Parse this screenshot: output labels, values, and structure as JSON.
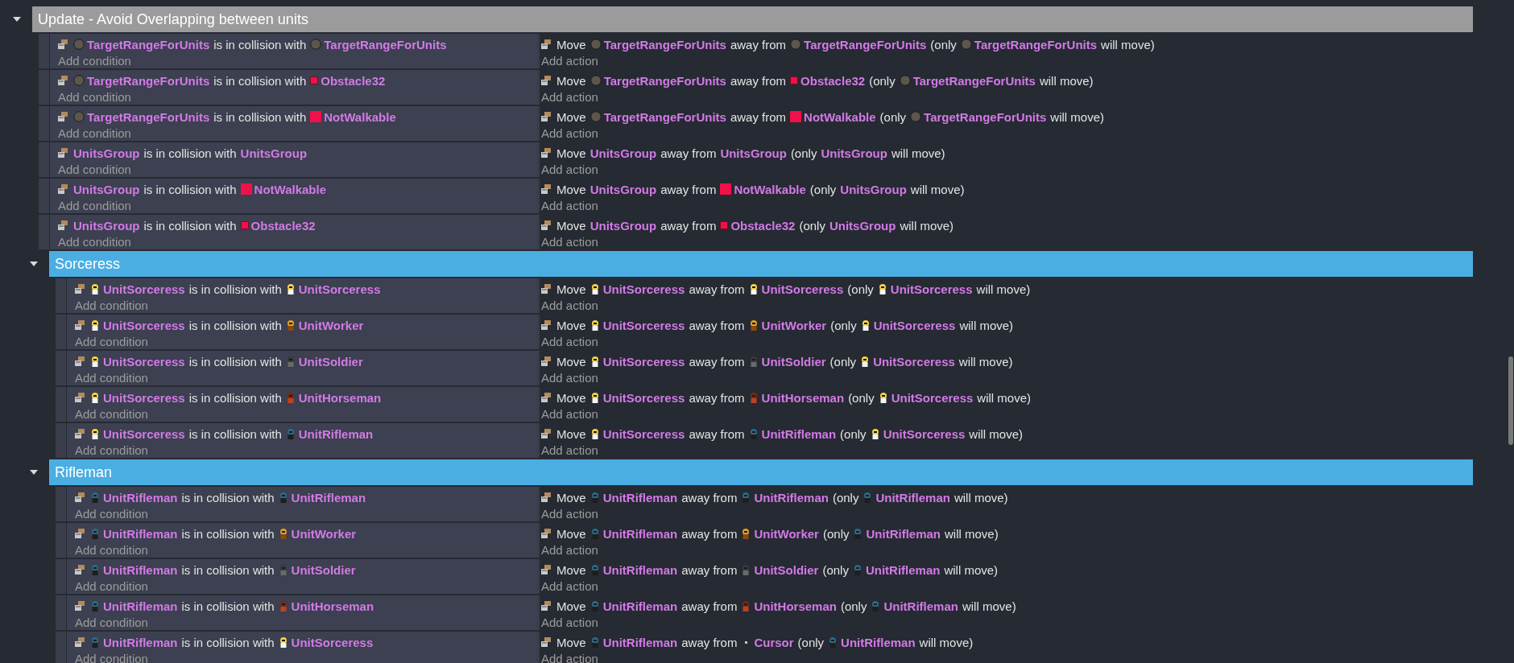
{
  "groups": [
    {
      "title": "Update - Avoid Overlapping between units",
      "color": "#9b9b9b",
      "expanded": true,
      "events": [
        {
          "condition": [
            {
              "kind": "circle",
              "text": "TargetRangeForUnits"
            },
            {
              "kind": "text",
              "text": "is in collision with"
            },
            {
              "kind": "circle",
              "text": "TargetRangeForUnits"
            }
          ],
          "add_condition": "Add condition",
          "action": [
            {
              "kind": "text",
              "text": "Move"
            },
            {
              "kind": "circle",
              "text": "TargetRangeForUnits"
            },
            {
              "kind": "text",
              "text": "away from"
            },
            {
              "kind": "circle",
              "text": "TargetRangeForUnits"
            },
            {
              "kind": "text",
              "text": "(only"
            },
            {
              "kind": "circle",
              "text": "TargetRangeForUnits"
            },
            {
              "kind": "text",
              "text": "will move)"
            }
          ],
          "add_action": "Add action"
        },
        {
          "condition": [
            {
              "kind": "circle",
              "text": "TargetRangeForUnits"
            },
            {
              "kind": "text",
              "text": "is in collision with"
            },
            {
              "kind": "tile",
              "text": "Obstacle32"
            }
          ],
          "add_condition": "Add condition",
          "action": [
            {
              "kind": "text",
              "text": "Move"
            },
            {
              "kind": "circle",
              "text": "TargetRangeForUnits"
            },
            {
              "kind": "text",
              "text": "away from"
            },
            {
              "kind": "tile",
              "text": "Obstacle32"
            },
            {
              "kind": "text",
              "text": "(only"
            },
            {
              "kind": "circle",
              "text": "TargetRangeForUnits"
            },
            {
              "kind": "text",
              "text": "will move)"
            }
          ],
          "add_action": "Add action"
        },
        {
          "condition": [
            {
              "kind": "circle",
              "text": "TargetRangeForUnits"
            },
            {
              "kind": "text",
              "text": "is in collision with"
            },
            {
              "kind": "square",
              "text": "NotWalkable"
            }
          ],
          "add_condition": "Add condition",
          "action": [
            {
              "kind": "text",
              "text": "Move"
            },
            {
              "kind": "circle",
              "text": "TargetRangeForUnits"
            },
            {
              "kind": "text",
              "text": "away from"
            },
            {
              "kind": "square",
              "text": "NotWalkable"
            },
            {
              "kind": "text",
              "text": "(only"
            },
            {
              "kind": "circle",
              "text": "TargetRangeForUnits"
            },
            {
              "kind": "text",
              "text": "will move)"
            }
          ],
          "add_action": "Add action"
        },
        {
          "condition": [
            {
              "kind": "group",
              "text": "UnitsGroup"
            },
            {
              "kind": "text",
              "text": "is in collision with"
            },
            {
              "kind": "group",
              "text": "UnitsGroup"
            }
          ],
          "add_condition": "Add condition",
          "action": [
            {
              "kind": "text",
              "text": "Move"
            },
            {
              "kind": "group",
              "text": "UnitsGroup"
            },
            {
              "kind": "text",
              "text": "away from"
            },
            {
              "kind": "group",
              "text": "UnitsGroup"
            },
            {
              "kind": "text",
              "text": "(only"
            },
            {
              "kind": "group",
              "text": "UnitsGroup"
            },
            {
              "kind": "text",
              "text": "will move)"
            }
          ],
          "add_action": "Add action"
        },
        {
          "condition": [
            {
              "kind": "group",
              "text": "UnitsGroup"
            },
            {
              "kind": "text",
              "text": "is in collision with"
            },
            {
              "kind": "square",
              "text": "NotWalkable"
            }
          ],
          "add_condition": "Add condition",
          "action": [
            {
              "kind": "text",
              "text": "Move"
            },
            {
              "kind": "group",
              "text": "UnitsGroup"
            },
            {
              "kind": "text",
              "text": "away from"
            },
            {
              "kind": "square",
              "text": "NotWalkable"
            },
            {
              "kind": "text",
              "text": "(only"
            },
            {
              "kind": "group",
              "text": "UnitsGroup"
            },
            {
              "kind": "text",
              "text": "will move)"
            }
          ],
          "add_action": "Add action"
        },
        {
          "condition": [
            {
              "kind": "group",
              "text": "UnitsGroup"
            },
            {
              "kind": "text",
              "text": "is in collision with"
            },
            {
              "kind": "tile",
              "text": "Obstacle32"
            }
          ],
          "add_condition": "Add condition",
          "action": [
            {
              "kind": "text",
              "text": "Move"
            },
            {
              "kind": "group",
              "text": "UnitsGroup"
            },
            {
              "kind": "text",
              "text": "away from"
            },
            {
              "kind": "tile",
              "text": "Obstacle32"
            },
            {
              "kind": "text",
              "text": "(only"
            },
            {
              "kind": "group",
              "text": "UnitsGroup"
            },
            {
              "kind": "text",
              "text": "will move)"
            }
          ],
          "add_action": "Add action"
        }
      ],
      "children": [
        {
          "title": "Sorceress",
          "color": "#4aaee2",
          "expanded": true,
          "events": [
            {
              "condition": [
                {
                  "kind": "sorceress",
                  "text": "UnitSorceress"
                },
                {
                  "kind": "text",
                  "text": "is in collision with"
                },
                {
                  "kind": "sorceress",
                  "text": "UnitSorceress"
                }
              ],
              "add_condition": "Add condition",
              "action": [
                {
                  "kind": "text",
                  "text": "Move"
                },
                {
                  "kind": "sorceress",
                  "text": "UnitSorceress"
                },
                {
                  "kind": "text",
                  "text": "away from"
                },
                {
                  "kind": "sorceress",
                  "text": "UnitSorceress"
                },
                {
                  "kind": "text",
                  "text": "(only"
                },
                {
                  "kind": "sorceress",
                  "text": "UnitSorceress"
                },
                {
                  "kind": "text",
                  "text": "will move)"
                }
              ],
              "add_action": "Add action"
            },
            {
              "condition": [
                {
                  "kind": "sorceress",
                  "text": "UnitSorceress"
                },
                {
                  "kind": "text",
                  "text": "is in collision with"
                },
                {
                  "kind": "worker",
                  "text": "UnitWorker"
                }
              ],
              "add_condition": "Add condition",
              "action": [
                {
                  "kind": "text",
                  "text": "Move"
                },
                {
                  "kind": "sorceress",
                  "text": "UnitSorceress"
                },
                {
                  "kind": "text",
                  "text": "away from"
                },
                {
                  "kind": "worker",
                  "text": "UnitWorker"
                },
                {
                  "kind": "text",
                  "text": "(only"
                },
                {
                  "kind": "sorceress",
                  "text": "UnitSorceress"
                },
                {
                  "kind": "text",
                  "text": "will move)"
                }
              ],
              "add_action": "Add action"
            },
            {
              "condition": [
                {
                  "kind": "sorceress",
                  "text": "UnitSorceress"
                },
                {
                  "kind": "text",
                  "text": "is in collision with"
                },
                {
                  "kind": "soldier",
                  "text": "UnitSoldier"
                }
              ],
              "add_condition": "Add condition",
              "action": [
                {
                  "kind": "text",
                  "text": "Move"
                },
                {
                  "kind": "sorceress",
                  "text": "UnitSorceress"
                },
                {
                  "kind": "text",
                  "text": "away from"
                },
                {
                  "kind": "soldier",
                  "text": "UnitSoldier"
                },
                {
                  "kind": "text",
                  "text": "(only"
                },
                {
                  "kind": "sorceress",
                  "text": "UnitSorceress"
                },
                {
                  "kind": "text",
                  "text": "will move)"
                }
              ],
              "add_action": "Add action"
            },
            {
              "condition": [
                {
                  "kind": "sorceress",
                  "text": "UnitSorceress"
                },
                {
                  "kind": "text",
                  "text": "is in collision with"
                },
                {
                  "kind": "horseman",
                  "text": "UnitHorseman"
                }
              ],
              "add_condition": "Add condition",
              "action": [
                {
                  "kind": "text",
                  "text": "Move"
                },
                {
                  "kind": "sorceress",
                  "text": "UnitSorceress"
                },
                {
                  "kind": "text",
                  "text": "away from"
                },
                {
                  "kind": "horseman",
                  "text": "UnitHorseman"
                },
                {
                  "kind": "text",
                  "text": "(only"
                },
                {
                  "kind": "sorceress",
                  "text": "UnitSorceress"
                },
                {
                  "kind": "text",
                  "text": "will move)"
                }
              ],
              "add_action": "Add action"
            },
            {
              "condition": [
                {
                  "kind": "sorceress",
                  "text": "UnitSorceress"
                },
                {
                  "kind": "text",
                  "text": "is in collision with"
                },
                {
                  "kind": "rifleman",
                  "text": "UnitRifleman"
                }
              ],
              "add_condition": "Add condition",
              "action": [
                {
                  "kind": "text",
                  "text": "Move"
                },
                {
                  "kind": "sorceress",
                  "text": "UnitSorceress"
                },
                {
                  "kind": "text",
                  "text": "away from"
                },
                {
                  "kind": "rifleman",
                  "text": "UnitRifleman"
                },
                {
                  "kind": "text",
                  "text": "(only"
                },
                {
                  "kind": "sorceress",
                  "text": "UnitSorceress"
                },
                {
                  "kind": "text",
                  "text": "will move)"
                }
              ],
              "add_action": "Add action"
            }
          ]
        },
        {
          "title": "Rifleman",
          "color": "#4aaee2",
          "expanded": true,
          "events": [
            {
              "condition": [
                {
                  "kind": "rifleman",
                  "text": "UnitRifleman"
                },
                {
                  "kind": "text",
                  "text": "is in collision with"
                },
                {
                  "kind": "rifleman",
                  "text": "UnitRifleman"
                }
              ],
              "add_condition": "Add condition",
              "action": [
                {
                  "kind": "text",
                  "text": "Move"
                },
                {
                  "kind": "rifleman",
                  "text": "UnitRifleman"
                },
                {
                  "kind": "text",
                  "text": "away from"
                },
                {
                  "kind": "rifleman",
                  "text": "UnitRifleman"
                },
                {
                  "kind": "text",
                  "text": "(only"
                },
                {
                  "kind": "rifleman",
                  "text": "UnitRifleman"
                },
                {
                  "kind": "text",
                  "text": "will move)"
                }
              ],
              "add_action": "Add action"
            },
            {
              "condition": [
                {
                  "kind": "rifleman",
                  "text": "UnitRifleman"
                },
                {
                  "kind": "text",
                  "text": "is in collision with"
                },
                {
                  "kind": "worker",
                  "text": "UnitWorker"
                }
              ],
              "add_condition": "Add condition",
              "action": [
                {
                  "kind": "text",
                  "text": "Move"
                },
                {
                  "kind": "rifleman",
                  "text": "UnitRifleman"
                },
                {
                  "kind": "text",
                  "text": "away from"
                },
                {
                  "kind": "worker",
                  "text": "UnitWorker"
                },
                {
                  "kind": "text",
                  "text": "(only"
                },
                {
                  "kind": "rifleman",
                  "text": "UnitRifleman"
                },
                {
                  "kind": "text",
                  "text": "will move)"
                }
              ],
              "add_action": "Add action"
            },
            {
              "condition": [
                {
                  "kind": "rifleman",
                  "text": "UnitRifleman"
                },
                {
                  "kind": "text",
                  "text": "is in collision with"
                },
                {
                  "kind": "soldier",
                  "text": "UnitSoldier"
                }
              ],
              "add_condition": "Add condition",
              "action": [
                {
                  "kind": "text",
                  "text": "Move"
                },
                {
                  "kind": "rifleman",
                  "text": "UnitRifleman"
                },
                {
                  "kind": "text",
                  "text": "away from"
                },
                {
                  "kind": "soldier",
                  "text": "UnitSoldier"
                },
                {
                  "kind": "text",
                  "text": "(only"
                },
                {
                  "kind": "rifleman",
                  "text": "UnitRifleman"
                },
                {
                  "kind": "text",
                  "text": "will move)"
                }
              ],
              "add_action": "Add action"
            },
            {
              "condition": [
                {
                  "kind": "rifleman",
                  "text": "UnitRifleman"
                },
                {
                  "kind": "text",
                  "text": "is in collision with"
                },
                {
                  "kind": "horseman",
                  "text": "UnitHorseman"
                }
              ],
              "add_condition": "Add condition",
              "action": [
                {
                  "kind": "text",
                  "text": "Move"
                },
                {
                  "kind": "rifleman",
                  "text": "UnitRifleman"
                },
                {
                  "kind": "text",
                  "text": "away from"
                },
                {
                  "kind": "horseman",
                  "text": "UnitHorseman"
                },
                {
                  "kind": "text",
                  "text": "(only"
                },
                {
                  "kind": "rifleman",
                  "text": "UnitRifleman"
                },
                {
                  "kind": "text",
                  "text": "will move)"
                }
              ],
              "add_action": "Add action"
            },
            {
              "condition": [
                {
                  "kind": "rifleman",
                  "text": "UnitRifleman"
                },
                {
                  "kind": "text",
                  "text": "is in collision with"
                },
                {
                  "kind": "sorceress",
                  "text": "UnitSorceress"
                }
              ],
              "add_condition": "Add condition",
              "action": [
                {
                  "kind": "text",
                  "text": "Move"
                },
                {
                  "kind": "rifleman",
                  "text": "UnitRifleman"
                },
                {
                  "kind": "text",
                  "text": "away from"
                },
                {
                  "kind": "cursor",
                  "text": "Cursor"
                },
                {
                  "kind": "text",
                  "text": "(only"
                },
                {
                  "kind": "rifleman",
                  "text": "UnitRifleman"
                },
                {
                  "kind": "text",
                  "text": "will move)"
                }
              ],
              "add_action": "Add action"
            }
          ]
        }
      ]
    }
  ]
}
